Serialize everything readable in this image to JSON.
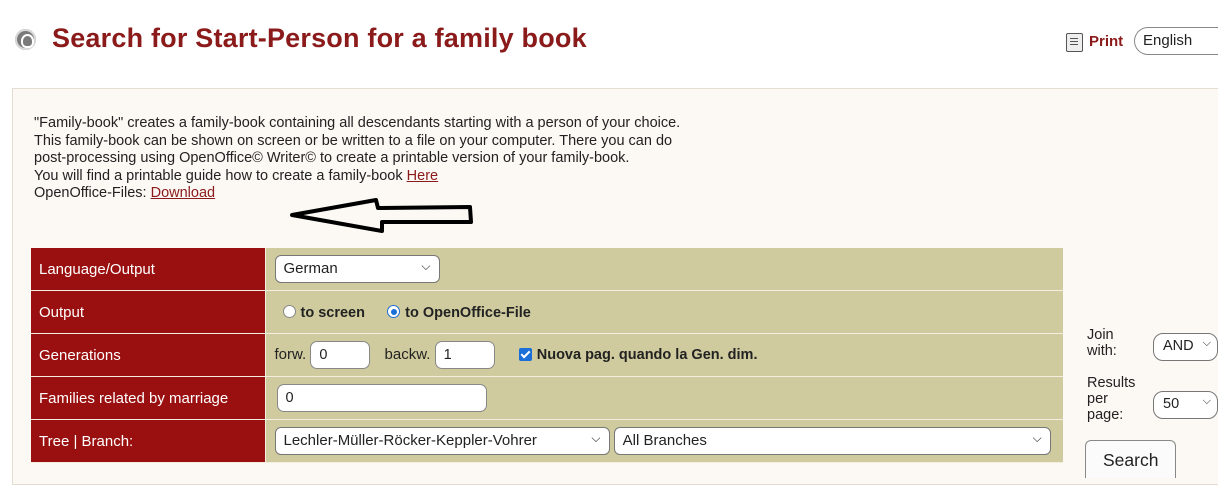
{
  "header": {
    "title": "Search for Start-Person for a family book",
    "print_label": "Print",
    "language_value": "English"
  },
  "intro": {
    "line1": "\"Family-book\" creates a family-book containing all descendants starting with a person of your choice.",
    "line2": "This family-book can be shown on screen or be written to a file on your computer. There you can do",
    "line3": "post-processing using OpenOffice© Writer© to create a printable version of your family-book.",
    "line4_text": "You will find a printable guide how to create a family-book ",
    "line4_link": "Here",
    "line5_text": "OpenOffice-Files: ",
    "line5_link": "Download"
  },
  "form": {
    "rows": [
      {
        "label": "Language/Output",
        "select_value": "German"
      },
      {
        "label": "Output",
        "radio1": "to screen",
        "radio2": "to OpenOffice-File",
        "selected": "to OpenOffice-File"
      },
      {
        "label": "Generations",
        "forw_label": "forw.",
        "forw_value": "0",
        "backw_label": "backw.",
        "backw_value": "1",
        "checkbox_label": "Nuova pag. quando la Gen. dim.",
        "checked": true
      },
      {
        "label": "Families related by marriage",
        "value": "0"
      },
      {
        "label": "Tree | Branch:",
        "tree_value": "Lechler-Müller-Röcker-Keppler-Vohrer",
        "branch_value": "All Branches"
      }
    ]
  },
  "side": {
    "join_label_1": "Join",
    "join_label_2": "with:",
    "join_value": "AND",
    "results_label_1": "Results",
    "results_label_2": "per",
    "results_label_3": "page:",
    "results_value": "50",
    "search_label": "Search"
  },
  "colors": {
    "title": "#8b1a1a",
    "label_bg": "#9a1010",
    "value_bg": "#cfcb9e",
    "accent": "#1a6fd8"
  }
}
